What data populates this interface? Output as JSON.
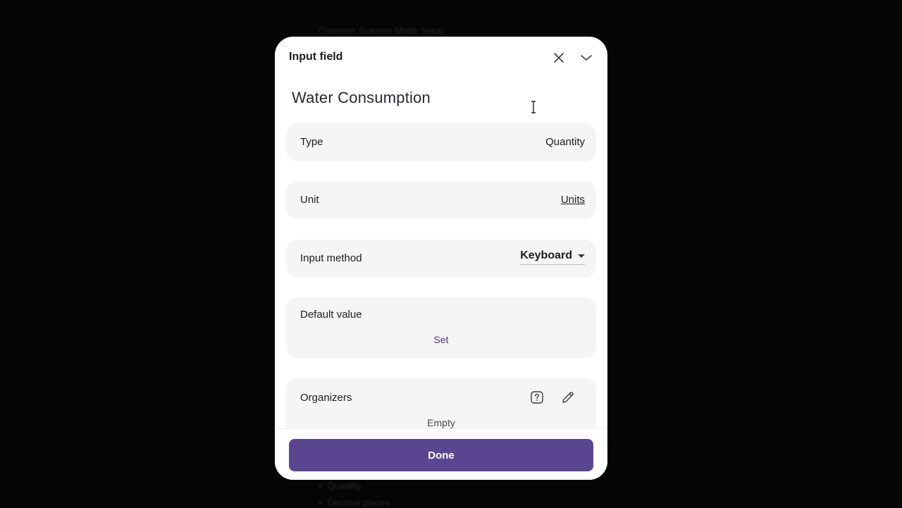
{
  "background": {
    "line1": "Common Scanner Mode Setup",
    "line2": "Quantity",
    "line3": "Decimal places"
  },
  "modal": {
    "title": "Input field",
    "field_name": "Water Consumption",
    "type": {
      "label": "Type",
      "value": "Quantity"
    },
    "unit": {
      "label": "Unit",
      "value": "Units"
    },
    "input_method": {
      "label": "Input method",
      "value": "Keyboard"
    },
    "default_value": {
      "label": "Default value",
      "action": "Set"
    },
    "organizers": {
      "label": "Organizers",
      "empty_text": "Empty"
    },
    "done_label": "Done"
  },
  "icons": {
    "close": "close-icon",
    "collapse": "chevron-down-icon",
    "help": "help-icon",
    "edit": "pencil-icon"
  },
  "colors": {
    "accent": "#5a4690",
    "link": "#4b3a84",
    "row_bg": "#f5f5f5"
  }
}
